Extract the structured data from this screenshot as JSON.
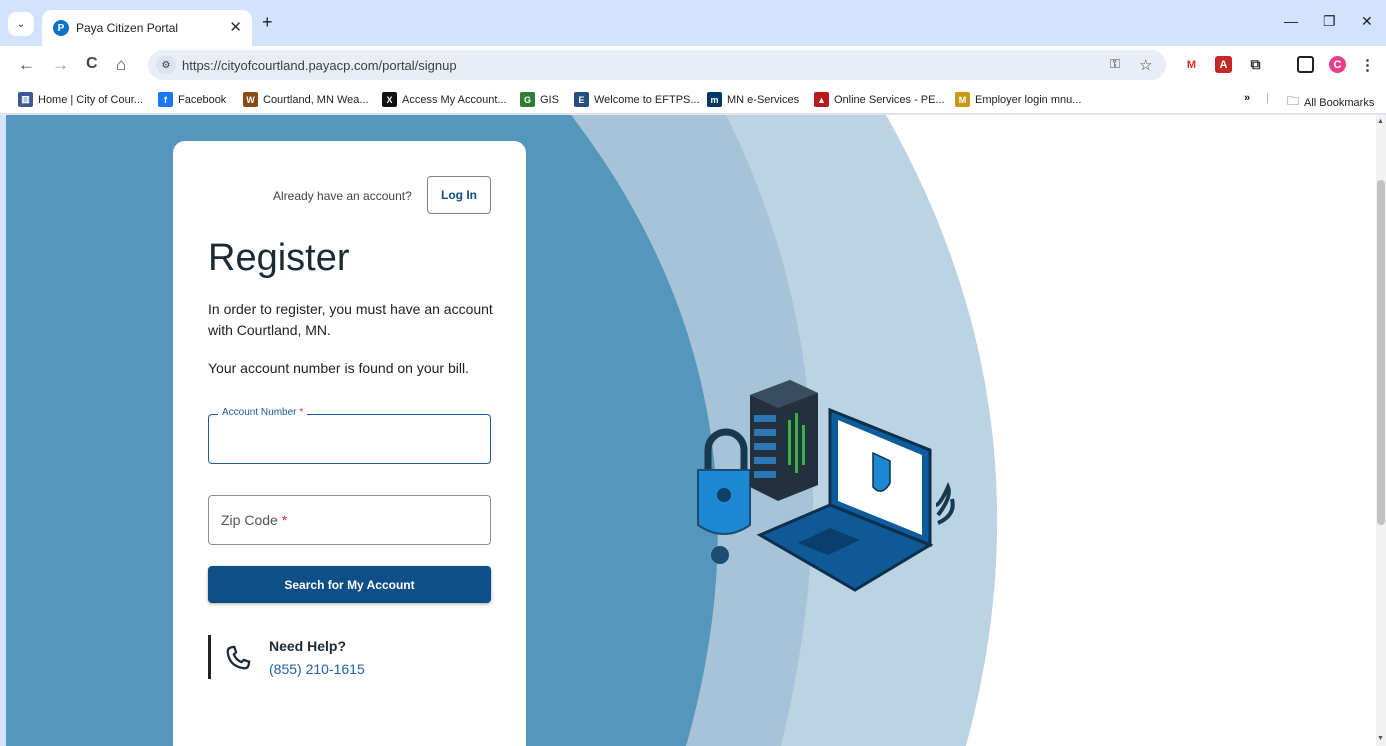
{
  "browser": {
    "tab_title": "Paya Citizen Portal",
    "tab_favicon_letter": "P",
    "url": "https://cityofcourtland.payacp.com/portal/signup",
    "bookmarks": [
      {
        "label": "Home | City of Cour...",
        "icon": "building-icon",
        "color": "#3b5a99",
        "glyph": "▥"
      },
      {
        "label": "Facebook",
        "icon": "facebook-icon",
        "color": "#1877f2",
        "glyph": "f"
      },
      {
        "label": "Courtland, MN Wea...",
        "icon": "weather-icon",
        "color": "#8b4a16",
        "glyph": "W"
      },
      {
        "label": "Access My Account...",
        "icon": "x-icon",
        "color": "#111111",
        "glyph": "X"
      },
      {
        "label": "GIS",
        "icon": "gis-icon",
        "color": "#2e7d32",
        "glyph": "G"
      },
      {
        "label": "Welcome to EFTPS...",
        "icon": "eftps-icon",
        "color": "#24507e",
        "glyph": "E"
      },
      {
        "label": "MN e-Services",
        "icon": "mn-icon",
        "color": "#003865",
        "glyph": "m"
      },
      {
        "label": "Online Services - PE...",
        "icon": "pera-icon",
        "color": "#b71c1c",
        "glyph": "▲"
      },
      {
        "label": "Employer login mnu...",
        "icon": "mnu-icon",
        "color": "#c79a12",
        "glyph": "M"
      }
    ],
    "all_bookmarks_label": "All Bookmarks",
    "profile_initial": "C"
  },
  "login_prompt": {
    "text": "Already have an account?",
    "button_label": "Log In"
  },
  "register": {
    "title": "Register",
    "description": "In order to register, you must have an account with Courtland, MN.",
    "note": "Your account number is found on your bill.",
    "account_number": {
      "label": "Account Number",
      "required_mark": "*",
      "value": ""
    },
    "zip_code": {
      "label": "Zip Code",
      "required_mark": "*",
      "value": ""
    },
    "submit_label": "Search for My Account"
  },
  "help": {
    "title": "Need Help?",
    "phone": "(855) 210-1615"
  },
  "colors": {
    "primary": "#0f4f88",
    "background_dark": "#5596bd",
    "background_mid": "#a6c3d8",
    "background_light": "#bcd3e3",
    "link": "#1d62a8"
  }
}
